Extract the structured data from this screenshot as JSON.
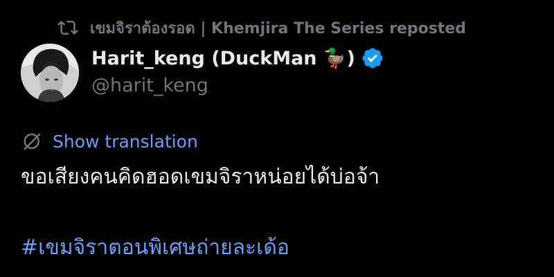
{
  "repost": {
    "text": "เขมจิราต้องรอด | Khemjira The Series reposted",
    "icon": "repost-icon"
  },
  "author": {
    "display_name": "Harit_keng (DuckMan 🦆)",
    "handle": "@harit_keng",
    "verified_icon": "verified-badge-icon"
  },
  "translation": {
    "label": "Show translation",
    "icon": "globe-icon"
  },
  "tweet": {
    "text": "ขอเสียงคนคิดฮอดเขมจิราหน่อยได้บ่อจ้า",
    "hashtag": "#เขมจิราตอนพิเศษถ่ายละเด้อ"
  },
  "colors": {
    "background": "#000000",
    "primary_text": "#e7e9ea",
    "secondary_text": "#71767b",
    "link": "#6e9ff5",
    "verified": "#1d9bf0"
  }
}
